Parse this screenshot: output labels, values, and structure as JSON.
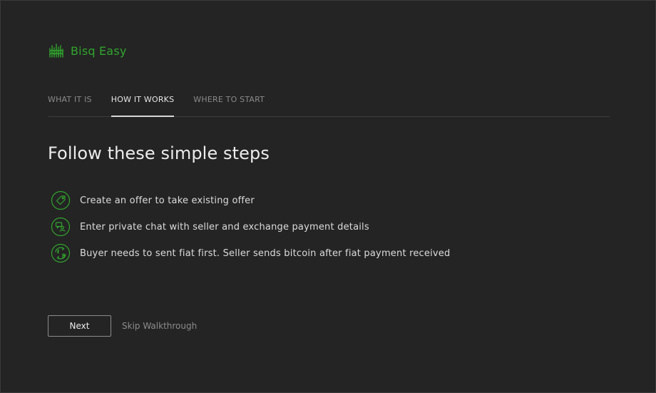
{
  "header": {
    "app_name": "Bisq Easy",
    "logo_icon": "bisq-easy-logo-icon",
    "accent_color": "#30a52d"
  },
  "tabs": [
    {
      "label": "WHAT IT IS",
      "active": false
    },
    {
      "label": "HOW IT WORKS",
      "active": true
    },
    {
      "label": "WHERE TO START",
      "active": false
    }
  ],
  "main": {
    "headline": "Follow these simple steps",
    "steps": [
      {
        "icon": "offer-tag-icon",
        "text": "Create an offer to take existing offer"
      },
      {
        "icon": "private-chat-icon",
        "text": "Enter private chat with seller and exchange payment details"
      },
      {
        "icon": "fiat-bitcoin-exchange-icon",
        "text": "Buyer needs to sent fiat first. Seller sends bitcoin after fiat payment received"
      }
    ]
  },
  "footer": {
    "next_label": "Next",
    "skip_label": "Skip Walkthrough"
  }
}
